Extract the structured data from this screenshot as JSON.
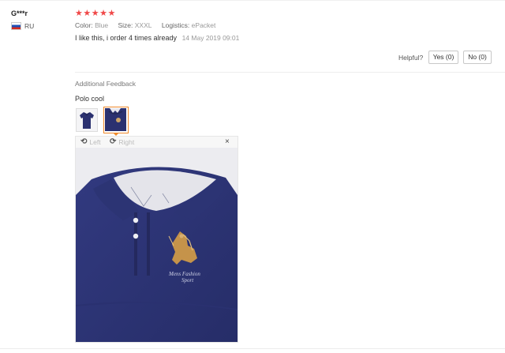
{
  "reviewer": {
    "name": "G***r",
    "country": "RU"
  },
  "rating": {
    "stars": 5,
    "display": "★★★★★"
  },
  "attributes": {
    "color_label": "Color:",
    "color_value": "Blue",
    "size_label": "Size:",
    "size_value": "XXXL",
    "logistics_label": "Logistics:",
    "logistics_value": "ePacket"
  },
  "review": {
    "text": "I like this, i order 4 times already",
    "date": "14 May 2019 09:01"
  },
  "helpful": {
    "label": "Helpful?",
    "yes_label": "Yes (0)",
    "no_label": "No (0)"
  },
  "additional": {
    "heading": "Additional Feedback",
    "text": "Polo cool"
  },
  "viewer": {
    "rotate_left_label": "Left",
    "rotate_right_label": "Right",
    "close_symbol": "×"
  },
  "icons": {
    "rotate_left": "rotate-left-icon",
    "rotate_right": "rotate-right-icon",
    "close": "close-icon",
    "flag": "russia-flag-icon"
  },
  "colors": {
    "stars": "#f04848",
    "shirt": "#2b3170",
    "selected_border": "#f08a2b"
  }
}
